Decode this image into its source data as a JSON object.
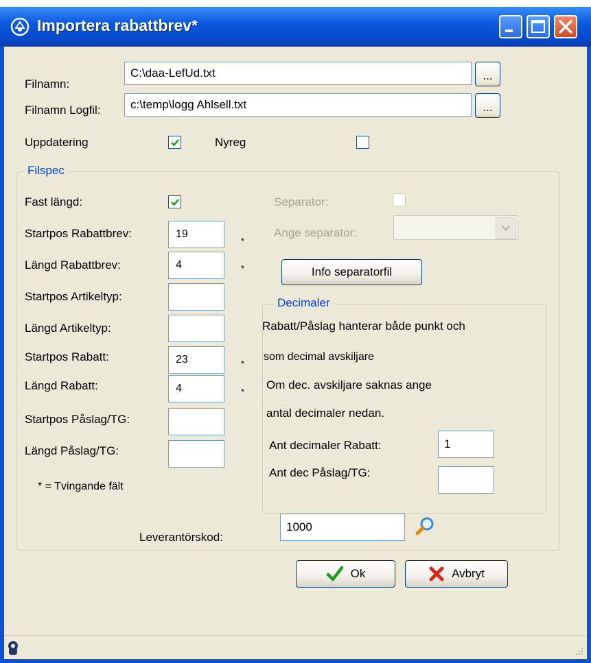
{
  "window": {
    "title": "Importera rabattbrev*"
  },
  "files": {
    "filename_label": "Filnamn:",
    "filename_value": "C:\\daa-LefUd.txt",
    "logfile_label": "Filnamn Logfil:",
    "logfile_value": "c:\\temp\\logg Ahlsell.txt",
    "browse_label": "..."
  },
  "options": {
    "update_label": "Uppdatering",
    "update_checked": true,
    "newreg_label": "Nyreg",
    "newreg_checked": false
  },
  "filspec": {
    "title": "Filspec",
    "fixed_length_label": "Fast längd:",
    "fixed_length_checked": true,
    "separator_label": "Separator:",
    "separator_checked": false,
    "ange_separator_label": "Ange separator:",
    "ange_separator_value": "",
    "info_button_label": "Info separatorfil",
    "required_marker": "*",
    "required_note": "* = Tvingande fält",
    "fields": [
      {
        "label": "Startpos Rabattbrev:",
        "value": "19",
        "required": true
      },
      {
        "label": "Längd Rabattbrev:",
        "value": "4",
        "required": true
      },
      {
        "label": "Startpos Artikeltyp:",
        "value": "",
        "required": false
      },
      {
        "label": "Längd Artikeltyp:",
        "value": "",
        "required": false
      },
      {
        "label": "Startpos Rabatt:",
        "value": "23",
        "required": true
      },
      {
        "label": "Längd Rabatt:",
        "value": "4",
        "required": true
      },
      {
        "label": "Startpos Påslag/TG:",
        "value": "",
        "required": false
      },
      {
        "label": "Längd Påslag/TG:",
        "value": "",
        "required": false
      }
    ],
    "decimaler": {
      "title": "Decimaler",
      "info_lines": [
        "Rabatt/Påslag hanterar både punkt och",
        "som decimal avskiljare",
        "Om dec. avskiljare saknas ange",
        "antal decimaler nedan."
      ],
      "rabatt_label": "Ant decimaler Rabatt:",
      "rabatt_value": "1",
      "paslag_label": "Ant dec Påslag/TG:",
      "paslag_value": ""
    }
  },
  "supplier": {
    "label": "Leverantörskod:",
    "value": "1000"
  },
  "buttons": {
    "ok_label": "Ok",
    "cancel_label": "Avbryt"
  },
  "colors": {
    "titlebar": "#0a52d6",
    "client_bg": "#ece9d8",
    "group_legend": "#0046d5",
    "check_green": "#21a121",
    "close_red": "#d34a22"
  }
}
